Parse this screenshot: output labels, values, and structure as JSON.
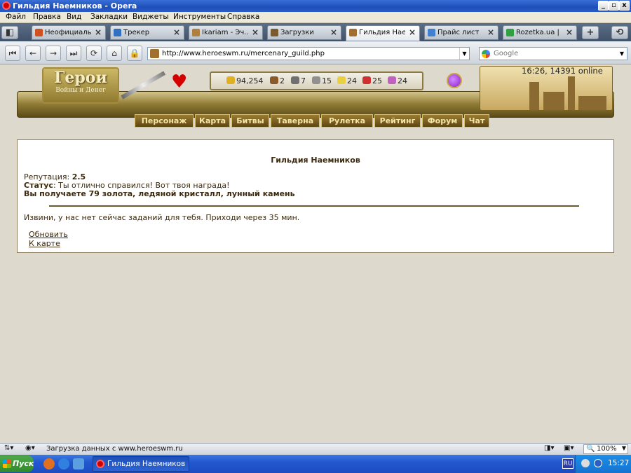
{
  "window": {
    "title": "Гильдия Наемников - Opera"
  },
  "menubar": [
    "Файл",
    "Правка",
    "Вид",
    "Закладки",
    "Виджеты",
    "Инструменты",
    "Справка"
  ],
  "tabs": [
    {
      "label": "Неофициаль...",
      "fav": "#d05020"
    },
    {
      "label": "Трекер",
      "fav": "#3070c0"
    },
    {
      "label": "Ikariam - Эч...",
      "fav": "#b08040"
    },
    {
      "label": "Загрузки",
      "fav": "#7a5a30"
    },
    {
      "label": "Гильдия Нае...",
      "fav": "#a07030",
      "active": true
    },
    {
      "label": "Прайс лист",
      "fav": "#4080d0"
    },
    {
      "label": "Rozetka.ua | ...",
      "fav": "#30a040"
    }
  ],
  "address": {
    "url": "http://www.heroeswm.ru/mercenary_guild.php"
  },
  "search": {
    "placeholder": "Google"
  },
  "game": {
    "logo_title": "Герои",
    "logo_sub": "Войны и Денег",
    "clock": "16:26, 14391 online",
    "resources": [
      {
        "icon": "gold-icon",
        "value": "94,254",
        "color": "#e0b020"
      },
      {
        "icon": "wood-icon",
        "value": "2",
        "color": "#8a5a2a"
      },
      {
        "icon": "ore-icon",
        "value": "7",
        "color": "#707070"
      },
      {
        "icon": "mercury-icon",
        "value": "15",
        "color": "#909090"
      },
      {
        "icon": "sulfur-icon",
        "value": "24",
        "color": "#e8d040"
      },
      {
        "icon": "crystal-icon",
        "value": "25",
        "color": "#d03030"
      },
      {
        "icon": "gem-icon",
        "value": "24",
        "color": "#c060c0"
      }
    ],
    "nav": [
      "Персонаж",
      "Карта",
      "Битвы",
      "Таверна",
      "Рулетка",
      "Рейтинг",
      "Форум",
      "Чат"
    ]
  },
  "guild": {
    "title": "Гильдия Наемников",
    "reputation_label": "Репутация:",
    "reputation_value": "2.5",
    "status_label": "Статус",
    "status_text": ": Ты отлично справился! Вот твоя награда!",
    "reward": "Вы получаете 79 золота, ледяной кристалл, лунный камень",
    "message": "Извини, у нас нет сейчас заданий для тебя. Приходи через 35 мин.",
    "links": [
      "Обновить",
      "К карте"
    ]
  },
  "statusbar": {
    "text": "Загрузка данных с www.heroeswm.ru",
    "zoom": "100%"
  },
  "taskbar": {
    "start": "Пуск",
    "task": "Гильдия Наемников -...",
    "lang": "RU",
    "time": "15:27"
  }
}
